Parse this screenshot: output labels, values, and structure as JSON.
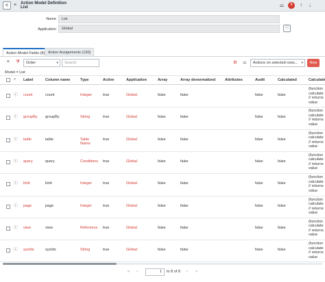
{
  "header": {
    "title_line1": "Action Model Definition",
    "title_line2": "List",
    "back_glyph": "<",
    "menu_glyph": "≡"
  },
  "form": {
    "name_label": "Name",
    "name_value": "List",
    "application_label": "Application",
    "application_value": "Global"
  },
  "tabs": [
    {
      "label": "Action Model Fields (8)",
      "active": true
    },
    {
      "label": "Action Assignments (130)",
      "active": false
    }
  ],
  "toolbar": {
    "search_field_selected": "Order",
    "search_placeholder": "Search",
    "actions_selected": "Actions on selected rows...",
    "new_label": "New"
  },
  "breadcrumb": "Model = List",
  "table": {
    "columns": [
      "Label",
      "Column name",
      "Type",
      "Active",
      "Application",
      "Array",
      "Array denormalized",
      "Attributes",
      "Audit",
      "Calculated",
      "Calculation"
    ],
    "rows": [
      {
        "label": "count",
        "column": "count",
        "type": "Integer",
        "active": "true",
        "application": "Global",
        "array": "false",
        "array_denorm": "false",
        "attributes": "",
        "audit": "false",
        "calculated": "false",
        "calculation": [
          "(function",
          "calculate",
          "// returns",
          "value"
        ]
      },
      {
        "label": "groupBy",
        "column": "groupBy",
        "type": "String",
        "active": "true",
        "application": "Global",
        "array": "false",
        "array_denorm": "false",
        "attributes": "",
        "audit": "false",
        "calculated": "false",
        "calculation": [
          "(function",
          "calculate",
          "// returns",
          "value"
        ]
      },
      {
        "label": "table",
        "column": "table",
        "type": "Table Name",
        "active": "true",
        "application": "Global",
        "array": "false",
        "array_denorm": "false",
        "attributes": "",
        "audit": "false",
        "calculated": "false",
        "calculation": [
          "(function",
          "calculate",
          "// returns",
          "value"
        ]
      },
      {
        "label": "query",
        "column": "query",
        "type": "Conditions",
        "active": "true",
        "application": "Global",
        "array": "false",
        "array_denorm": "false",
        "attributes": "",
        "audit": "false",
        "calculated": "false",
        "calculation": [
          "(function",
          "calculate",
          "// returns",
          "value"
        ]
      },
      {
        "label": "limit",
        "column": "limit",
        "type": "Integer",
        "active": "true",
        "application": "Global",
        "array": "false",
        "array_denorm": "false",
        "attributes": "",
        "audit": "false",
        "calculated": "false",
        "calculation": [
          "(function",
          "calculate",
          "// returns",
          "value"
        ]
      },
      {
        "label": "page",
        "column": "page",
        "type": "Integer",
        "active": "true",
        "application": "Global",
        "array": "false",
        "array_denorm": "false",
        "attributes": "",
        "audit": "false",
        "calculated": "false",
        "calculation": [
          "(function",
          "calculate",
          "// returns",
          "value"
        ]
      },
      {
        "label": "view",
        "column": "view",
        "type": "Reference",
        "active": "true",
        "application": "Global",
        "array": "false",
        "array_denorm": "false",
        "attributes": "",
        "audit": "false",
        "calculated": "false",
        "calculation": [
          "(function",
          "calculate",
          "// returns",
          "value"
        ]
      },
      {
        "label": "sysIds",
        "column": "sysIds",
        "type": "String",
        "active": "true",
        "application": "Global",
        "array": "false",
        "array_denorm": "false",
        "attributes": "",
        "audit": "false",
        "calculated": "false",
        "calculation": [
          "(function",
          "calculate",
          "// returns",
          "value"
        ]
      }
    ]
  },
  "pagination": {
    "first_glyph": "«",
    "prev_glyph": "‹",
    "next_glyph": "›",
    "last_glyph": "»",
    "current_page": "1",
    "range_text": "to 8 of 8"
  },
  "colors": {
    "link": "#d3392f",
    "new_button": "#e05a4f",
    "header_bg": "#e9ecef"
  }
}
